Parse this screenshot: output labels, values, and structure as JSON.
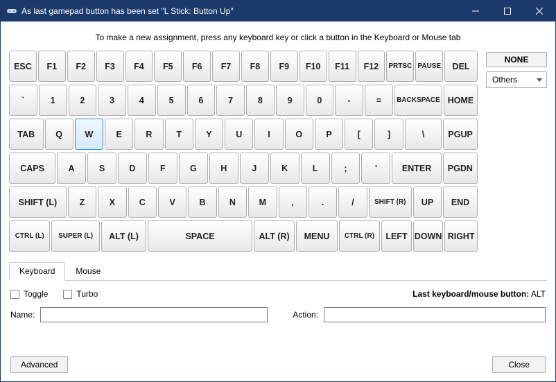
{
  "window": {
    "title": "As last gamepad button has been set \"L Stick: Button Up\""
  },
  "instruction": "To make a new assignment, press any keyboard key or click a button in the Keyboard or Mouse tab",
  "side": {
    "none": "NONE",
    "others": "Others"
  },
  "kb": {
    "r1": [
      "ESC",
      "F1",
      "F2",
      "F3",
      "F4",
      "F5",
      "F6",
      "F7",
      "F8",
      "F9",
      "F10",
      "F11",
      "F12",
      "PRTSC",
      "PAUSE",
      "DEL"
    ],
    "r2": [
      "`",
      "1",
      "2",
      "3",
      "4",
      "5",
      "6",
      "7",
      "8",
      "9",
      "0",
      "-",
      "=",
      "BACKSPACE",
      "HOME"
    ],
    "r3": [
      "TAB",
      "Q",
      "W",
      "E",
      "R",
      "T",
      "Y",
      "U",
      "I",
      "O",
      "P",
      "[",
      "]",
      "\\",
      "PGUP"
    ],
    "r4": [
      "CAPS",
      "A",
      "S",
      "D",
      "F",
      "G",
      "H",
      "J",
      "K",
      "L",
      ";",
      "'",
      "ENTER",
      "PGDN"
    ],
    "r5": [
      "SHIFT (L)",
      "Z",
      "X",
      "C",
      "V",
      "B",
      "N",
      "M",
      ",",
      ".",
      "/",
      "SHIFT (R)",
      "UP",
      "END"
    ],
    "r6": [
      "CTRL (L)",
      "SUPER (L)",
      "ALT (L)",
      "SPACE",
      "ALT (R)",
      "MENU",
      "CTRL (R)",
      "LEFT",
      "DOWN",
      "RIGHT"
    ],
    "selected": "W"
  },
  "tabs": {
    "keyboard": "Keyboard",
    "mouse": "Mouse"
  },
  "options": {
    "toggle": "Toggle",
    "turbo": "Turbo"
  },
  "last": {
    "label": "Last keyboard/mouse button:",
    "value": "ALT"
  },
  "fields": {
    "name_label": "Name:",
    "name_value": "",
    "action_label": "Action:",
    "action_value": ""
  },
  "footer": {
    "advanced": "Advanced",
    "close": "Close"
  }
}
